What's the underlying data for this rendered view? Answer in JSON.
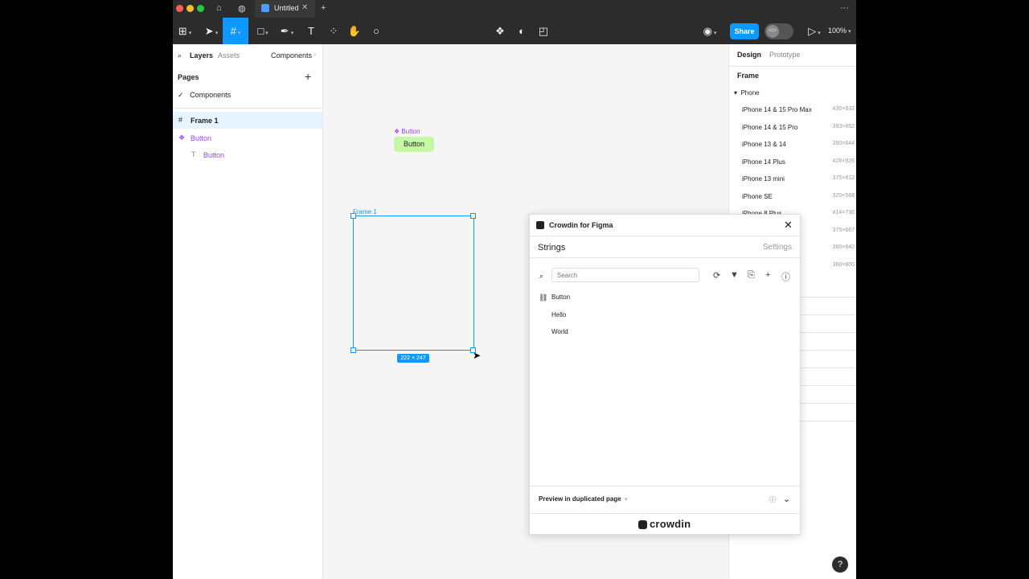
{
  "tab": {
    "title": "Untitled"
  },
  "toolbar": {
    "share_label": "Share",
    "zoom": "100%"
  },
  "left_panel": {
    "tabs": [
      "Layers",
      "Assets"
    ],
    "components_dropdown": "Components",
    "pages_heading": "Pages",
    "pages": [
      {
        "label": "Components"
      }
    ],
    "layers": [
      {
        "label": "Frame 1"
      },
      {
        "label": "Button"
      },
      {
        "label": "Button"
      }
    ]
  },
  "canvas": {
    "component_label": "Button",
    "component_button_text": "Button",
    "frame_label": "Frame 1",
    "frame_dims": "222 × 247"
  },
  "right_panel": {
    "tabs": [
      "Design",
      "Prototype"
    ],
    "section": "Frame",
    "category": "Phone",
    "presets": [
      {
        "name": "iPhone 14 & 15 Pro Max",
        "size": "430×932"
      },
      {
        "name": "iPhone 14 & 15 Pro",
        "size": "393×852"
      },
      {
        "name": "iPhone 13 & 14",
        "size": "390×844"
      },
      {
        "name": "iPhone 14 Plus",
        "size": "428×926"
      },
      {
        "name": "iPhone 13 mini",
        "size": "375×812"
      },
      {
        "name": "iPhone SE",
        "size": "320×568"
      },
      {
        "name": "iPhone 8 Plus",
        "size": "414×736"
      },
      {
        "name": "",
        "size": "375×667"
      },
      {
        "name": "",
        "size": "360×640"
      },
      {
        "name": "",
        "size": "360×800"
      }
    ]
  },
  "plugin": {
    "title": "Crowdin for Figma",
    "nav_strings": "Strings",
    "nav_settings": "Settings",
    "search_placeholder": "Search",
    "strings": [
      "Button",
      "Hello",
      "World"
    ],
    "preview_label": "Preview in duplicated page",
    "brand": "crowdin"
  },
  "colors": {
    "accent": "#0d99ff",
    "component": "#9747ff",
    "button_fill": "#c5f8a6"
  }
}
